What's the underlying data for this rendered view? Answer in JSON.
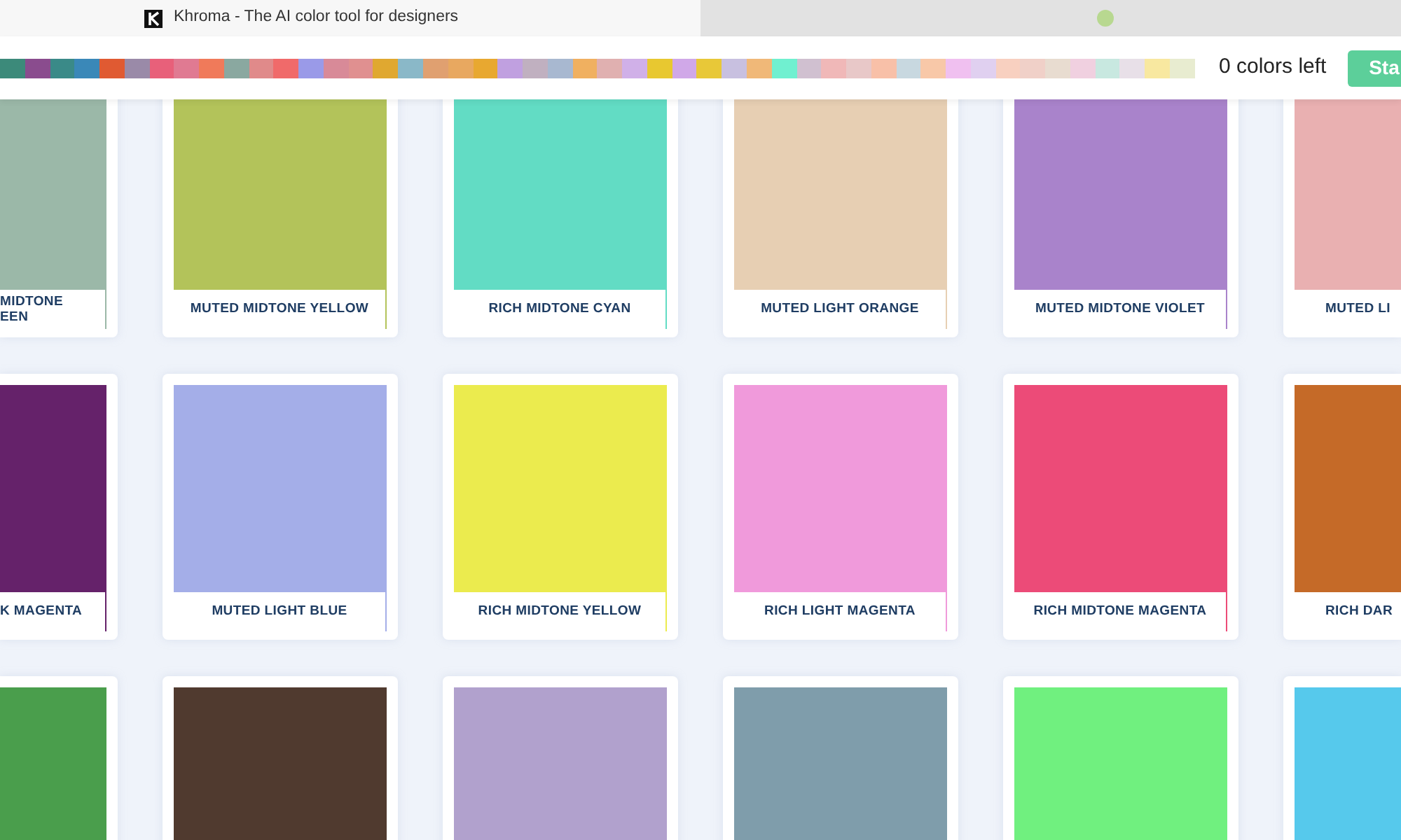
{
  "browser": {
    "tabs": [
      {
        "title": "Khroma - The AI color tool for designers",
        "selected": true
      },
      {
        "selected": false
      }
    ]
  },
  "palette": [
    {
      "color": "#3c8a7a"
    },
    {
      "color": "#8a4c8e"
    },
    {
      "color": "#3a8a88"
    },
    {
      "color": "#3a88b8"
    },
    {
      "color": "#e05a32"
    },
    {
      "color": "#9a8aa8"
    },
    {
      "color": "#e8607a"
    },
    {
      "color": "#e07a92"
    },
    {
      "color": "#f07a5a"
    },
    {
      "color": "#8aa8a0"
    },
    {
      "color": "#e08a8a"
    },
    {
      "color": "#f06a6a"
    },
    {
      "color": "#9a9ae8"
    },
    {
      "color": "#d88a98"
    },
    {
      "color": "#e09090"
    },
    {
      "color": "#e0a830"
    },
    {
      "color": "#8ab8c8"
    },
    {
      "color": "#e0a070"
    },
    {
      "color": "#e8a860"
    },
    {
      "color": "#e8a830"
    },
    {
      "color": "#c0a0e0"
    },
    {
      "color": "#c0b0c0"
    },
    {
      "color": "#a8b8d0"
    },
    {
      "color": "#f0b060"
    },
    {
      "color": "#e0b0b0"
    },
    {
      "color": "#d0b0e8"
    },
    {
      "color": "#e8c830"
    },
    {
      "color": "#d0a8e8"
    },
    {
      "color": "#e8c838"
    },
    {
      "color": "#c8c0e0"
    },
    {
      "color": "#f0b878"
    },
    {
      "color": "#70f0d0"
    },
    {
      "color": "#d0c0d0"
    },
    {
      "color": "#f0b8b8"
    },
    {
      "color": "#e8c8c8"
    },
    {
      "color": "#f8c0a8"
    },
    {
      "color": "#c8d8e0"
    },
    {
      "color": "#f8c8a8"
    },
    {
      "color": "#f0c0f0"
    },
    {
      "color": "#e0d0f0"
    },
    {
      "color": "#f8d0c0"
    },
    {
      "color": "#f0d0c8"
    },
    {
      "color": "#e8dcd0"
    },
    {
      "color": "#f0d0e0"
    },
    {
      "color": "#c8e8e0"
    },
    {
      "color": "#e8e0e8"
    },
    {
      "color": "#f8e8a0"
    },
    {
      "color": "#e8ecd0"
    }
  ],
  "colors_left": "0 colors left",
  "start_button": "Sta",
  "rows": [
    [
      {
        "kind": "partial-left",
        "color": "#9bb8a8",
        "label": "MIDTONE EEN"
      },
      {
        "kind": "full",
        "color": "#b3c35a",
        "label": "MUTED MIDTONE YELLOW"
      },
      {
        "kind": "full",
        "color": "#62dcc4",
        "label": "RICH MIDTONE CYAN"
      },
      {
        "kind": "full",
        "color": "#e7cfb3",
        "label": "MUTED LIGHT ORANGE"
      },
      {
        "kind": "full",
        "color": "#a983cb",
        "label": "MUTED MIDTONE VIOLET"
      },
      {
        "kind": "partial-right",
        "color": "#e9b0b1",
        "label": "MUTED LI"
      }
    ],
    [
      {
        "kind": "partial-left",
        "color": "#65226a",
        "label": "K MAGENTA"
      },
      {
        "kind": "full",
        "color": "#a4aee8",
        "label": "MUTED LIGHT BLUE"
      },
      {
        "kind": "full",
        "color": "#ebeb4e",
        "label": "RICH MIDTONE YELLOW"
      },
      {
        "kind": "full",
        "color": "#f09adb",
        "label": "RICH LIGHT MAGENTA"
      },
      {
        "kind": "full",
        "color": "#ec4b78",
        "label": "RICH MIDTONE MAGENTA"
      },
      {
        "kind": "partial-right",
        "color": "#c56a28",
        "label": "RICH DAR"
      }
    ],
    [
      {
        "kind": "partial-left",
        "color": "#4a9e4c"
      },
      {
        "kind": "full",
        "color": "#503a2f"
      },
      {
        "kind": "full",
        "color": "#b1a1cd"
      },
      {
        "kind": "full",
        "color": "#7f9dab"
      },
      {
        "kind": "full",
        "color": "#70f07f"
      },
      {
        "kind": "partial-right",
        "color": "#56c9ec"
      }
    ]
  ]
}
